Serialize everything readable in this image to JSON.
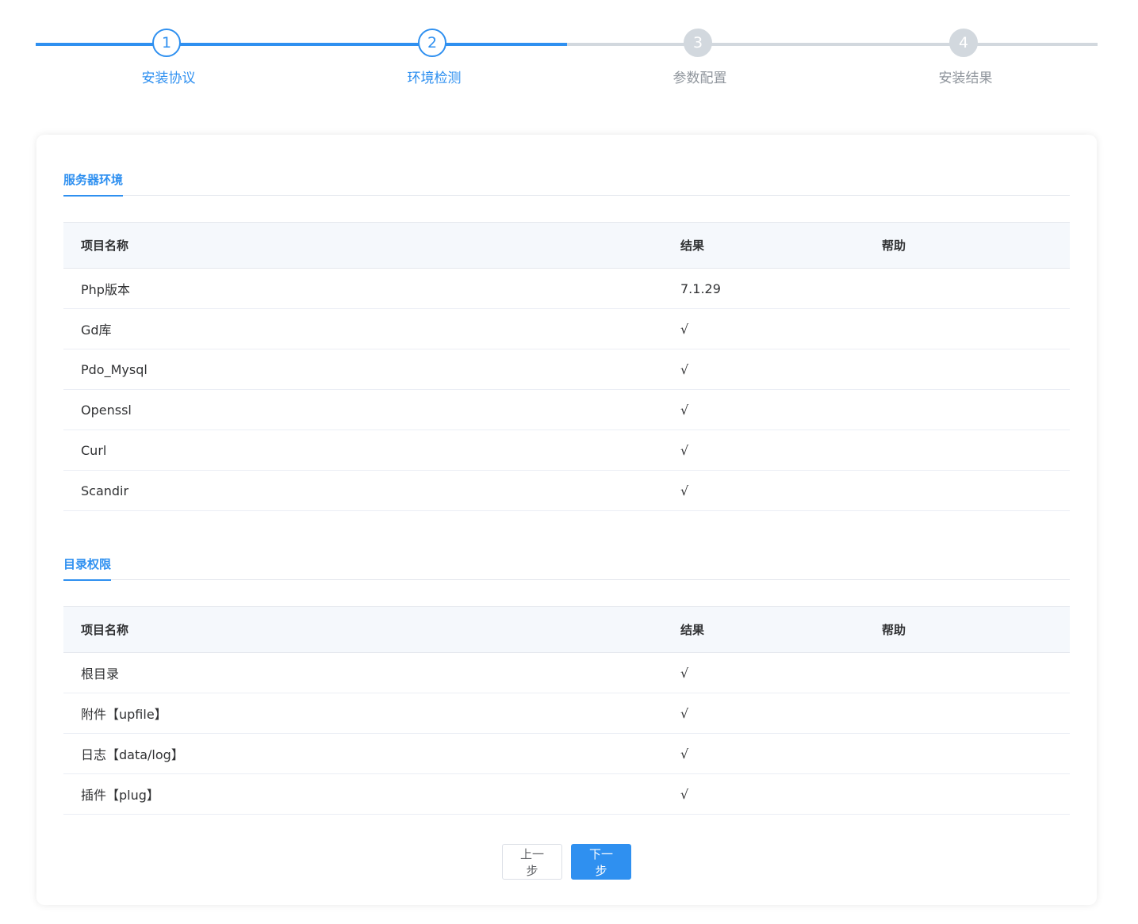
{
  "steps": [
    {
      "number": "1",
      "label": "安装协议",
      "state": "done"
    },
    {
      "number": "2",
      "label": "环境检测",
      "state": "active"
    },
    {
      "number": "3",
      "label": "参数配置",
      "state": "pending"
    },
    {
      "number": "4",
      "label": "安装结果",
      "state": "pending"
    }
  ],
  "server_env": {
    "tab_label": "服务器环境",
    "headers": {
      "name": "项目名称",
      "result": "结果",
      "help": "帮助"
    },
    "rows": [
      {
        "name": "Php版本",
        "result": "7.1.29",
        "help": ""
      },
      {
        "name": "Gd库",
        "result": "√",
        "help": ""
      },
      {
        "name": "Pdo_Mysql",
        "result": "√",
        "help": ""
      },
      {
        "name": "Openssl",
        "result": "√",
        "help": ""
      },
      {
        "name": "Curl",
        "result": "√",
        "help": ""
      },
      {
        "name": "Scandir",
        "result": "√",
        "help": ""
      }
    ]
  },
  "dir_perm": {
    "tab_label": "目录权限",
    "headers": {
      "name": "项目名称",
      "result": "结果",
      "help": "帮助"
    },
    "rows": [
      {
        "name": "根目录",
        "result": "√",
        "help": ""
      },
      {
        "name": "附件【upfile】",
        "result": "√",
        "help": ""
      },
      {
        "name": "日志【data/log】",
        "result": "√",
        "help": ""
      },
      {
        "name": "插件【plug】",
        "result": "√",
        "help": ""
      }
    ]
  },
  "buttons": {
    "prev": "上一步",
    "next": "下一步"
  },
  "colors": {
    "accent": "#2f90f0",
    "pending": "#d2d8de"
  }
}
